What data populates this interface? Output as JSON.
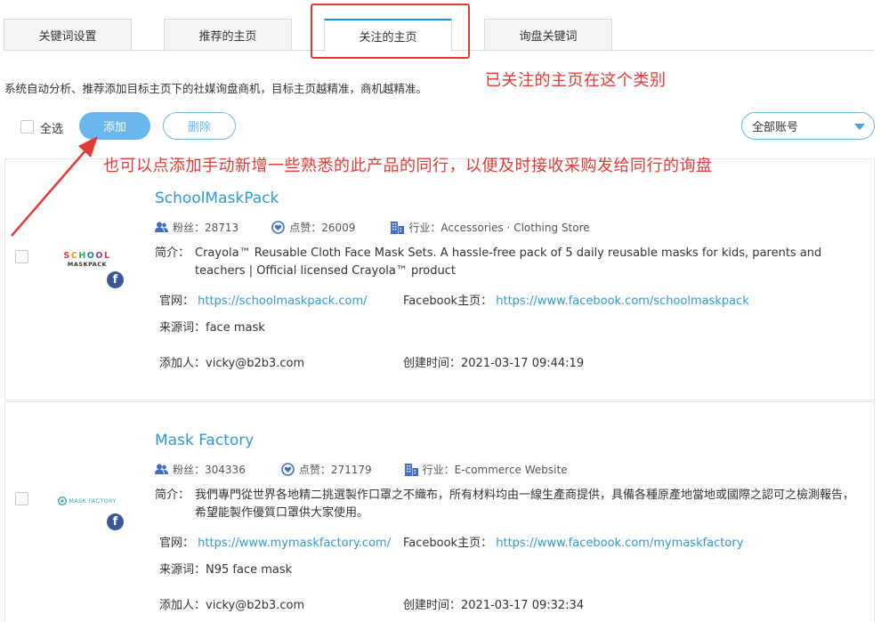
{
  "tabs": [
    {
      "label": "关键词设置",
      "active": false
    },
    {
      "label": "推荐的主页",
      "active": false
    },
    {
      "label": "关注的主页",
      "active": true
    },
    {
      "label": "询盘关键词",
      "active": false
    }
  ],
  "description": "系统自动分析、推荐添加目标主页下的社媒询盘商机，目标主页越精准，商机越精准。",
  "annotations": {
    "tab_note": "已关注的主页在这个类别",
    "add_note": "也可以点添加手动新增一些熟悉的此产品的同行，以便及时接收采购发给同行的询盘"
  },
  "toolbar": {
    "select_all_label": "全选",
    "add_label": "添加",
    "delete_label": "删除",
    "account_select": "全部账号"
  },
  "labels": {
    "fans": "粉丝：",
    "likes": "点赞：",
    "industry": "行业：",
    "intro": "简介：",
    "website": "官网：",
    "facebook": "Facebook主页：",
    "source": "来源词：",
    "added_by": "添加人：",
    "created": "创建时间："
  },
  "pages": [
    {
      "name": "SchoolMaskPack",
      "logo_text_top": "SCHOOL",
      "logo_text_bottom": "MASKPACK",
      "fans": "28713",
      "likes": "26009",
      "industry": "Accessories · Clothing Store",
      "intro": "Crayola™ Reusable Cloth Face Mask Sets. A hassle-free pack of 5 daily reusable masks for kids, parents and teachers | Official licensed Crayola™ product",
      "website": "https://schoolmaskpack.com/",
      "facebook": "https://www.facebook.com/schoolmaskpack",
      "source": "face mask",
      "added_by": "vicky@b2b3.com",
      "created": "2021-03-17 09:44:19"
    },
    {
      "name": "Mask Factory",
      "logo_text": "MASK FACTORY",
      "fans": "304336",
      "likes": "271179",
      "industry": "E-commerce Website",
      "intro": "我們專門從世界各地精⼆挑選製作口罩之不織布，所有材料均由一線生產商提供，具備各種原產地當地或國際之認可之檢測報告，希望能製作優質口罩供大家使用。",
      "website": "https://www.mymaskfactory.com/",
      "facebook": "https://www.facebook.com/mymaskfactory",
      "source": "N95 face mask",
      "added_by": "vicky@b2b3.com",
      "created": "2021-03-17 09:32:34"
    }
  ],
  "colors": {
    "accent": "#6ab6ee",
    "link": "#2e9bd6",
    "annotation_red": "#e53935",
    "facebook_blue": "#3b5998"
  }
}
